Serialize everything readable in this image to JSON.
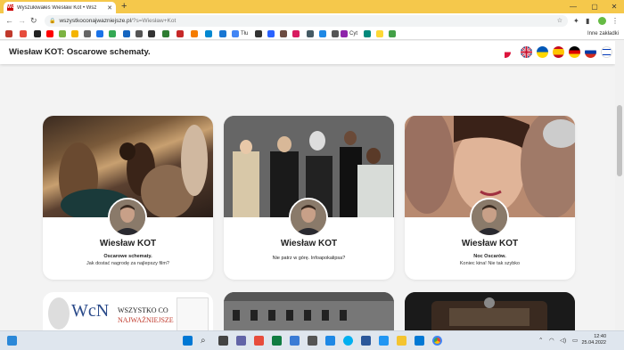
{
  "browser": {
    "tab_title": "Wyszukiwałeś Wiesław Kot • Wsz",
    "tab_favicon": "WcN",
    "new_tab": "+",
    "url_host": "wszystkoconajwazniejsze.pl",
    "url_path": "/?s=Wiesław+Kot",
    "other_bookmarks": "Inne zakładki",
    "bookmark_labels": [
      "Tłu",
      "Cyt"
    ],
    "colors": {
      "tabbar": "#f5c84b",
      "omnibox": "#f1f3f4"
    }
  },
  "site": {
    "title": "Wiesław KOT: Oscarowe schematy.",
    "flags": [
      "poland",
      "uk",
      "ukraine",
      "spain",
      "germany",
      "russia",
      "israel"
    ]
  },
  "cards": [
    {
      "author": "Wiesław KOT",
      "line1": "Oscarowe schematy.",
      "line2": "Jak dostać nagrodę za najlepszy film?"
    },
    {
      "author": "Wiesław KOT",
      "line1": "",
      "line2": "Nie patrz w górę. Infoapokalipsa?"
    },
    {
      "author": "Wiesław KOT",
      "line1": "Noc Oscarów.",
      "line2": "Koniec kina! Nie tak szybko"
    }
  ],
  "lower_cards": {
    "logo_top": "WSZYSTKO CO",
    "logo_bottom": "NAJWAŻNIEJSZE",
    "logo_mark": "WcN"
  },
  "taskbar": {
    "time": "12:40",
    "date": "25.04.2022"
  }
}
